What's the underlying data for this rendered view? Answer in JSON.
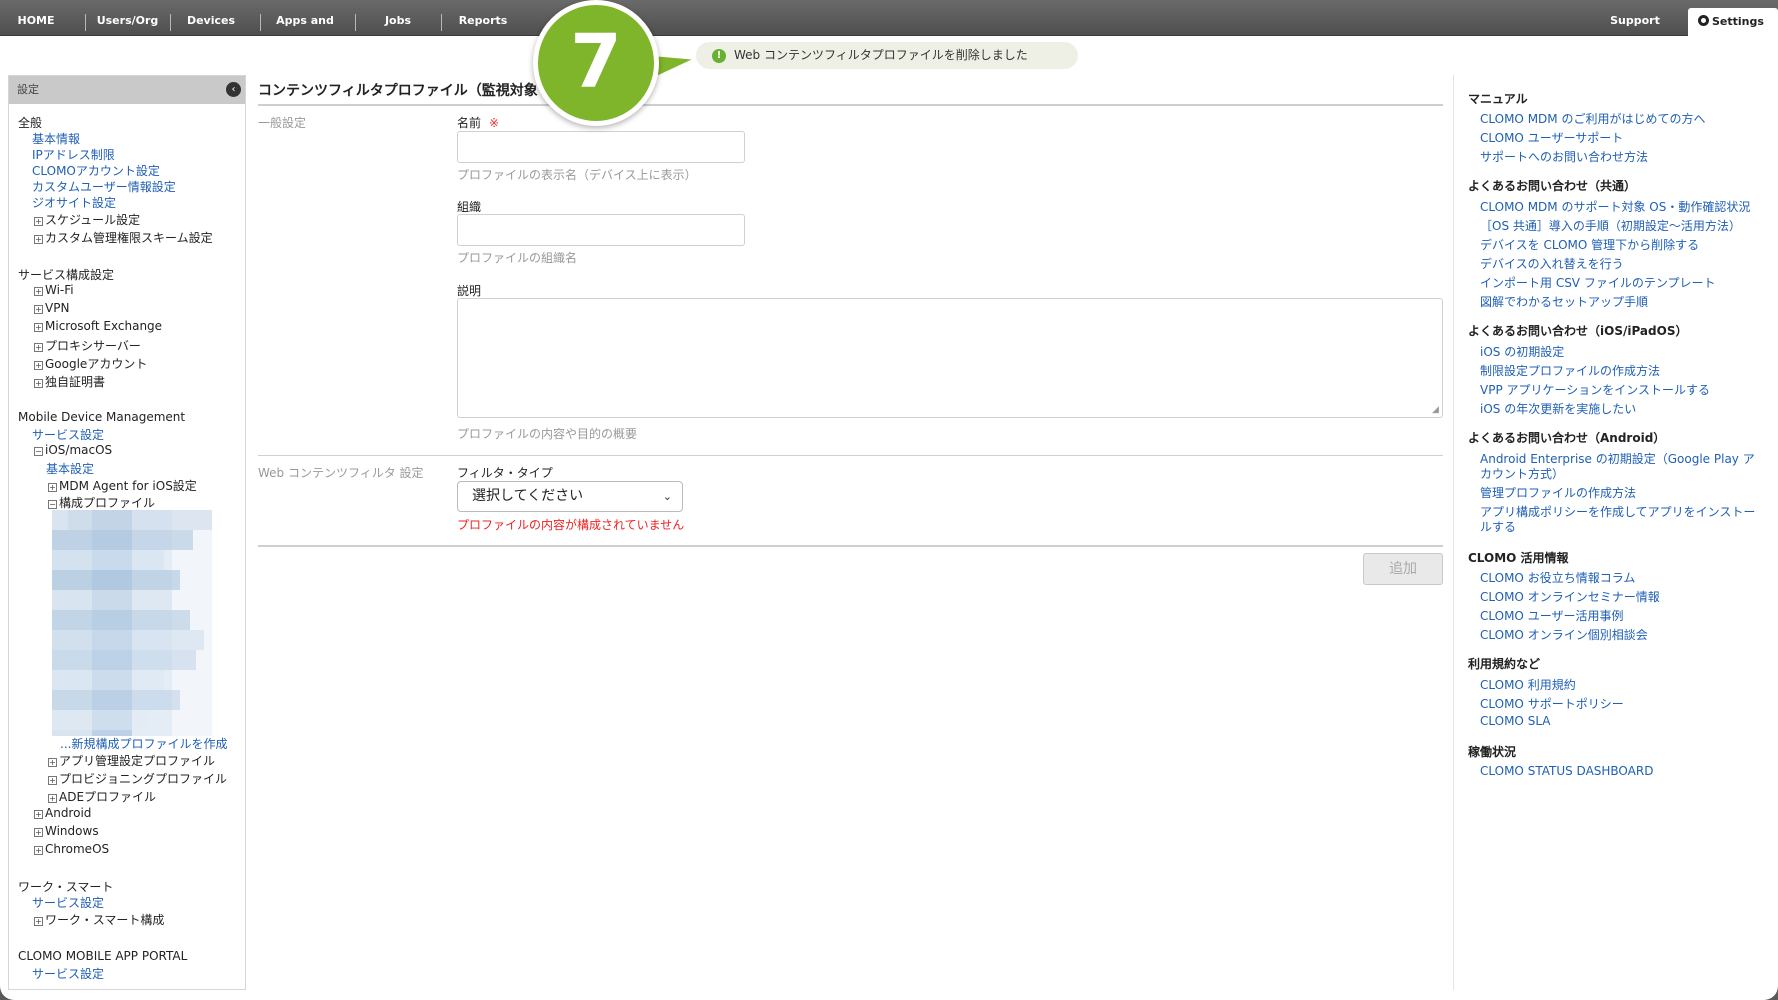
{
  "nav": {
    "items": [
      "HOME",
      "Users/Org",
      "Devices",
      "Apps and Books",
      "Jobs",
      "Reports"
    ],
    "support": "Support",
    "settings": "Settings"
  },
  "toast": {
    "message": "Web コンテンツフィルタプロファイルを削除しました"
  },
  "step": {
    "number": "7"
  },
  "sidebar": {
    "title": "設定",
    "general_head": "全般",
    "general_links": [
      "基本情報",
      "IPアドレス制限",
      "CLOMOアカウント設定",
      "カスタムユーザー情報設定",
      "ジオサイト設定"
    ],
    "general_items": [
      "スケジュール設定",
      "カスタム管理権限スキーム設定"
    ],
    "service_head": "サービス構成設定",
    "service_items": [
      "Wi-Fi",
      "VPN",
      "Microsoft Exchange",
      "プロキシサーバー",
      "Googleアカウント",
      "独自証明書"
    ],
    "mdm_head": "Mobile Device Management",
    "mdm_service": "サービス設定",
    "ios_macos": "iOS/macOS",
    "basic_settings": "基本設定",
    "mdm_agent": "MDM Agent for iOS設定",
    "config_profile": "構成プロファイル",
    "new_profile": "...新規構成プロファイルを作成",
    "ios_items": [
      "アプリ管理設定プロファイル",
      "プロビジョニングプロファイル",
      "ADEプロファイル"
    ],
    "os_items": [
      "Android",
      "Windows",
      "ChromeOS"
    ],
    "work_head": "ワーク・スマート",
    "work_service": "サービス設定",
    "work_item": "ワーク・スマート構成",
    "portal_head": "CLOMO MOBILE APP PORTAL",
    "portal_service": "サービス設定"
  },
  "main": {
    "title": "コンテンツフィルタプロファイル（監視対象",
    "general_section": "一般設定",
    "name_label": "名前",
    "required_mark": "※",
    "name_hint": "プロファイルの表示名（デバイス上に表示）",
    "org_label": "組織",
    "org_hint": "プロファイルの組織名",
    "desc_label": "説明",
    "desc_hint": "プロファイルの内容や目的の概要",
    "web_section": "Web コンテンツフィルタ 設定",
    "filter_label": "フィルタ・タイプ",
    "filter_value": "選択してください",
    "error": "プロファイルの内容が構成されていません",
    "add_button": "追加"
  },
  "right": {
    "sections": [
      {
        "head": "マニュアル",
        "links": [
          "CLOMO MDM のご利用がはじめての方へ",
          "CLOMO ユーザーサポート",
          "サポートへのお問い合わせ方法"
        ]
      },
      {
        "head": "よくあるお問い合わせ（共通）",
        "links": [
          "CLOMO MDM のサポート対象 OS・動作確認状況",
          "［OS 共通］導入の手順（初期設定〜活用方法）",
          "デバイスを CLOMO 管理下から削除する",
          "デバイスの入れ替えを行う",
          "インポート用 CSV ファイルのテンプレート",
          "図解でわかるセットアップ手順"
        ]
      },
      {
        "head": "よくあるお問い合わせ（iOS/iPadOS）",
        "links": [
          "iOS の初期設定",
          "制限設定プロファイルの作成方法",
          "VPP アプリケーションをインストールする",
          "iOS の年次更新を実施したい"
        ]
      },
      {
        "head": "よくあるお問い合わせ（Android）",
        "links": [
          "Android Enterprise の初期設定（Google Play ア",
          "カウント方式）",
          "管理プロファイルの作成方法",
          "アプリ構成ポリシーを作成してアプリをインストー",
          "ルする"
        ]
      },
      {
        "head": "CLOMO 活用情報",
        "links": [
          "CLOMO お役立ち情報コラム",
          "CLOMO オンラインセミナー情報",
          "CLOMO ユーザー活用事例",
          "CLOMO オンライン個別相談会"
        ]
      },
      {
        "head": "利用規約など",
        "links": [
          "CLOMO 利用規約",
          "CLOMO サポートポリシー",
          "CLOMO SLA"
        ]
      },
      {
        "head": "稼働状況",
        "links": [
          "CLOMO STATUS DASHBOARD"
        ]
      }
    ]
  }
}
